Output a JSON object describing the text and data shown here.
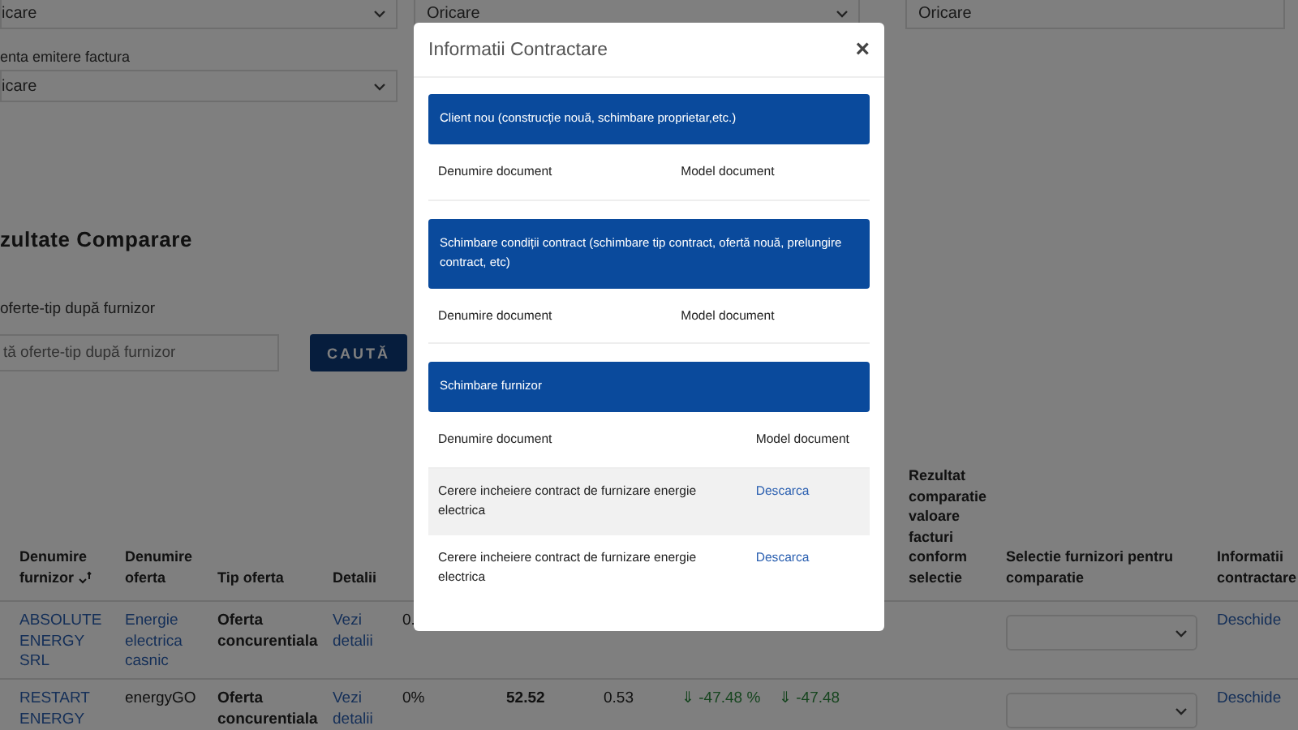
{
  "filters": [
    {
      "value": "icare",
      "chevron": true
    },
    {
      "value": "Oricare",
      "chevron": true
    },
    {
      "value": "Oricare",
      "chevron": false
    }
  ],
  "invoice_filter": {
    "label": "enta emitere factura",
    "value": "icare",
    "chevron": true
  },
  "results_heading": "zultate Comparare",
  "search": {
    "label": "oferte-tip după furnizor",
    "placeholder": "tă oferte-tip după furnizor",
    "button": "CAUTĂ"
  },
  "table": {
    "columns": [
      {
        "label": "Denumire furnizor",
        "sorted": true
      },
      {
        "label": "Denumire oferta",
        "sorted": false
      },
      {
        "label": "Tip oferta",
        "sorted": false
      },
      {
        "label": "Detalii",
        "sorted": false
      },
      null,
      null,
      null,
      null,
      null,
      {
        "label": "Rezultat comparatie valoare facturi conform selectie",
        "sorted": false
      },
      {
        "label": "Selectie furnizori pentru comparatie",
        "sorted": false
      },
      {
        "label": "Informatii contractare",
        "sorted": false
      }
    ],
    "rows": [
      [
        {
          "kind": "link",
          "text": "ABSOLUTE ENERGY SRL"
        },
        {
          "kind": "link",
          "text": "Energie electrica casnic"
        },
        {
          "kind": "bold",
          "text": "Oferta concurentiala"
        },
        {
          "kind": "link",
          "text": "Vezi detalii"
        },
        {
          "kind": "text",
          "text": "0."
        },
        null,
        null,
        null,
        null,
        null,
        {
          "kind": "select"
        },
        {
          "kind": "link",
          "text": "Deschide"
        }
      ],
      [
        {
          "kind": "link",
          "text": "RESTART ENERGY"
        },
        {
          "kind": "text",
          "text": "energyGO"
        },
        {
          "kind": "bold",
          "text": "Oferta concurentiala"
        },
        {
          "kind": "link",
          "text": "Vezi detalii"
        },
        {
          "kind": "text",
          "text": "0%"
        },
        {
          "kind": "bold",
          "text": "52.52"
        },
        {
          "kind": "text",
          "text": "0.53"
        },
        {
          "kind": "change",
          "text": "⇓ -47.48 %"
        },
        {
          "kind": "change",
          "text": "⇓ -47.48"
        },
        null,
        {
          "kind": "select"
        },
        {
          "kind": "link",
          "text": "Deschide"
        }
      ]
    ]
  },
  "modal": {
    "title": "Informatii Contractare",
    "close": "×",
    "sections": [
      {
        "title": "Client nou (construcție nouă, schimbare proprietar,etc.)",
        "columns": [
          "Denumire document",
          "Model document"
        ]
      },
      {
        "title": "Schimbare condiții contract (schimbare tip contract, ofertă nouă, prelungire contract, etc)",
        "columns": [
          "Denumire document",
          "Model document"
        ]
      },
      {
        "title": "Schimbare furnizor",
        "columns": [
          "Denumire document",
          "Model document"
        ],
        "rows": [
          {
            "name": "Cerere incheiere contract de furnizare energie electrica",
            "link": "Descarca"
          },
          {
            "name": "Cerere incheiere contract de furnizare energie electrica",
            "link": "Descarca"
          }
        ]
      }
    ]
  }
}
